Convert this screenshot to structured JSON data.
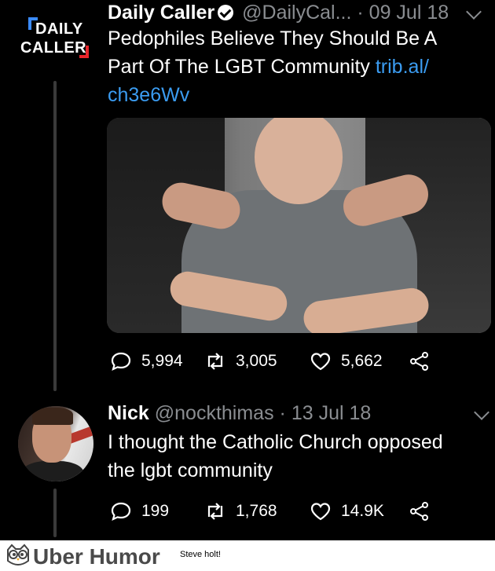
{
  "tweet": {
    "author_name": "Daily Caller",
    "handle": "@DailyCal...",
    "date": "· 09 Jul 18",
    "text_line1": "Pedophiles Believe They Should Be A",
    "text_line2_start": "Part Of The LGBT Community ",
    "link_part1": "trib.al/",
    "link_part2": "ch3e6Wv",
    "logo_line1": "DAILY",
    "logo_line2": "CALLER",
    "replies": "5,994",
    "retweets": "3,005",
    "likes": "5,662"
  },
  "reply": {
    "author_name": "Nick",
    "handle": "@nockthimas",
    "date": "· 13 Jul 18",
    "text_line1": "I thought the Catholic Church opposed",
    "text_line2": "the lgbt community",
    "replies": "199",
    "retweets": "1,768",
    "likes": "14.9K"
  },
  "footer": {
    "brand": "Uber Humor",
    "caption": "Steve holt!"
  },
  "icons": [
    "verified-badge-icon",
    "chevron-down-icon",
    "reply-icon",
    "retweet-icon",
    "like-icon",
    "share-icon",
    "owl-logo-icon"
  ],
  "colors": {
    "link": "#3b9cf1",
    "muted": "#8a8d91",
    "logo_blue": "#3b8bff",
    "logo_red": "#e8252b"
  }
}
